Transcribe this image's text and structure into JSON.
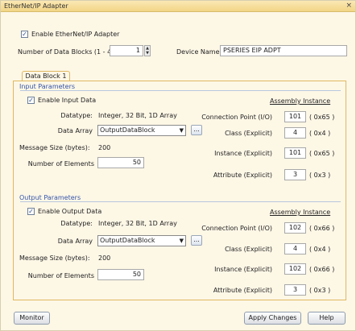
{
  "window": {
    "title": "EtherNet/IP Adapter",
    "close_glyph": "×"
  },
  "general": {
    "enable_label": "Enable EtherNet/IP Adapter",
    "enable_checked": true,
    "num_blocks_label": "Number of Data Blocks (1 - 4)",
    "num_blocks_value": "1",
    "device_name_label": "Device Name",
    "device_name_value": "PSERIES EIP ADPT"
  },
  "tab": {
    "label": "Data Block 1"
  },
  "input": {
    "section_title": "Input Parameters",
    "enable_label": "Enable Input Data",
    "enable_checked": true,
    "datatype_label": "Datatype:",
    "datatype_value": "Integer, 32 Bit, 1D Array",
    "data_array_label": "Data Array",
    "data_array_value": "OutputDataBlock",
    "message_size_label": "Message Size (bytes):",
    "message_size_value": "200",
    "num_elements_label": "Number of Elements",
    "num_elements_value": "50",
    "assembly_heading": "Assembly Instance",
    "connection_point_label": "Connection Point (I/O)",
    "connection_point_value": "101",
    "connection_point_hex": "( 0x65 )",
    "class_label": "Class (Explicit)",
    "class_value": "4",
    "class_hex": "( 0x4 )",
    "instance_label": "Instance (Explicit)",
    "instance_value": "101",
    "instance_hex": "( 0x65 )",
    "attribute_label": "Attribute (Explicit)",
    "attribute_value": "3",
    "attribute_hex": "( 0x3 )"
  },
  "output": {
    "section_title": "Output Parameters",
    "enable_label": "Enable Output Data",
    "enable_checked": true,
    "datatype_label": "Datatype:",
    "datatype_value": "Integer, 32 Bit, 1D Array",
    "data_array_label": "Data Array",
    "data_array_value": "OutputDataBlock",
    "message_size_label": "Message Size (bytes):",
    "message_size_value": "200",
    "num_elements_label": "Number of Elements",
    "num_elements_value": "50",
    "assembly_heading": "Assembly Instance",
    "connection_point_label": "Connection Point (I/O)",
    "connection_point_value": "102",
    "connection_point_hex": "( 0x66 )",
    "class_label": "Class (Explicit)",
    "class_value": "4",
    "class_hex": "( 0x4 )",
    "instance_label": "Instance (Explicit)",
    "instance_value": "102",
    "instance_hex": "( 0x66 )",
    "attribute_label": "Attribute (Explicit)",
    "attribute_value": "3",
    "attribute_hex": "( 0x3 )"
  },
  "buttons": {
    "monitor": "Monitor",
    "apply": "Apply Changes",
    "help": "Help",
    "ellipsis": "..."
  },
  "glyphs": {
    "check": "✓",
    "dropdown": "▼",
    "spin_up": "▲",
    "spin_down": "▼"
  },
  "colors": {
    "title_bar": "#f2d585",
    "section_title": "#3355aa",
    "window_bg": "#fdf7e6"
  }
}
